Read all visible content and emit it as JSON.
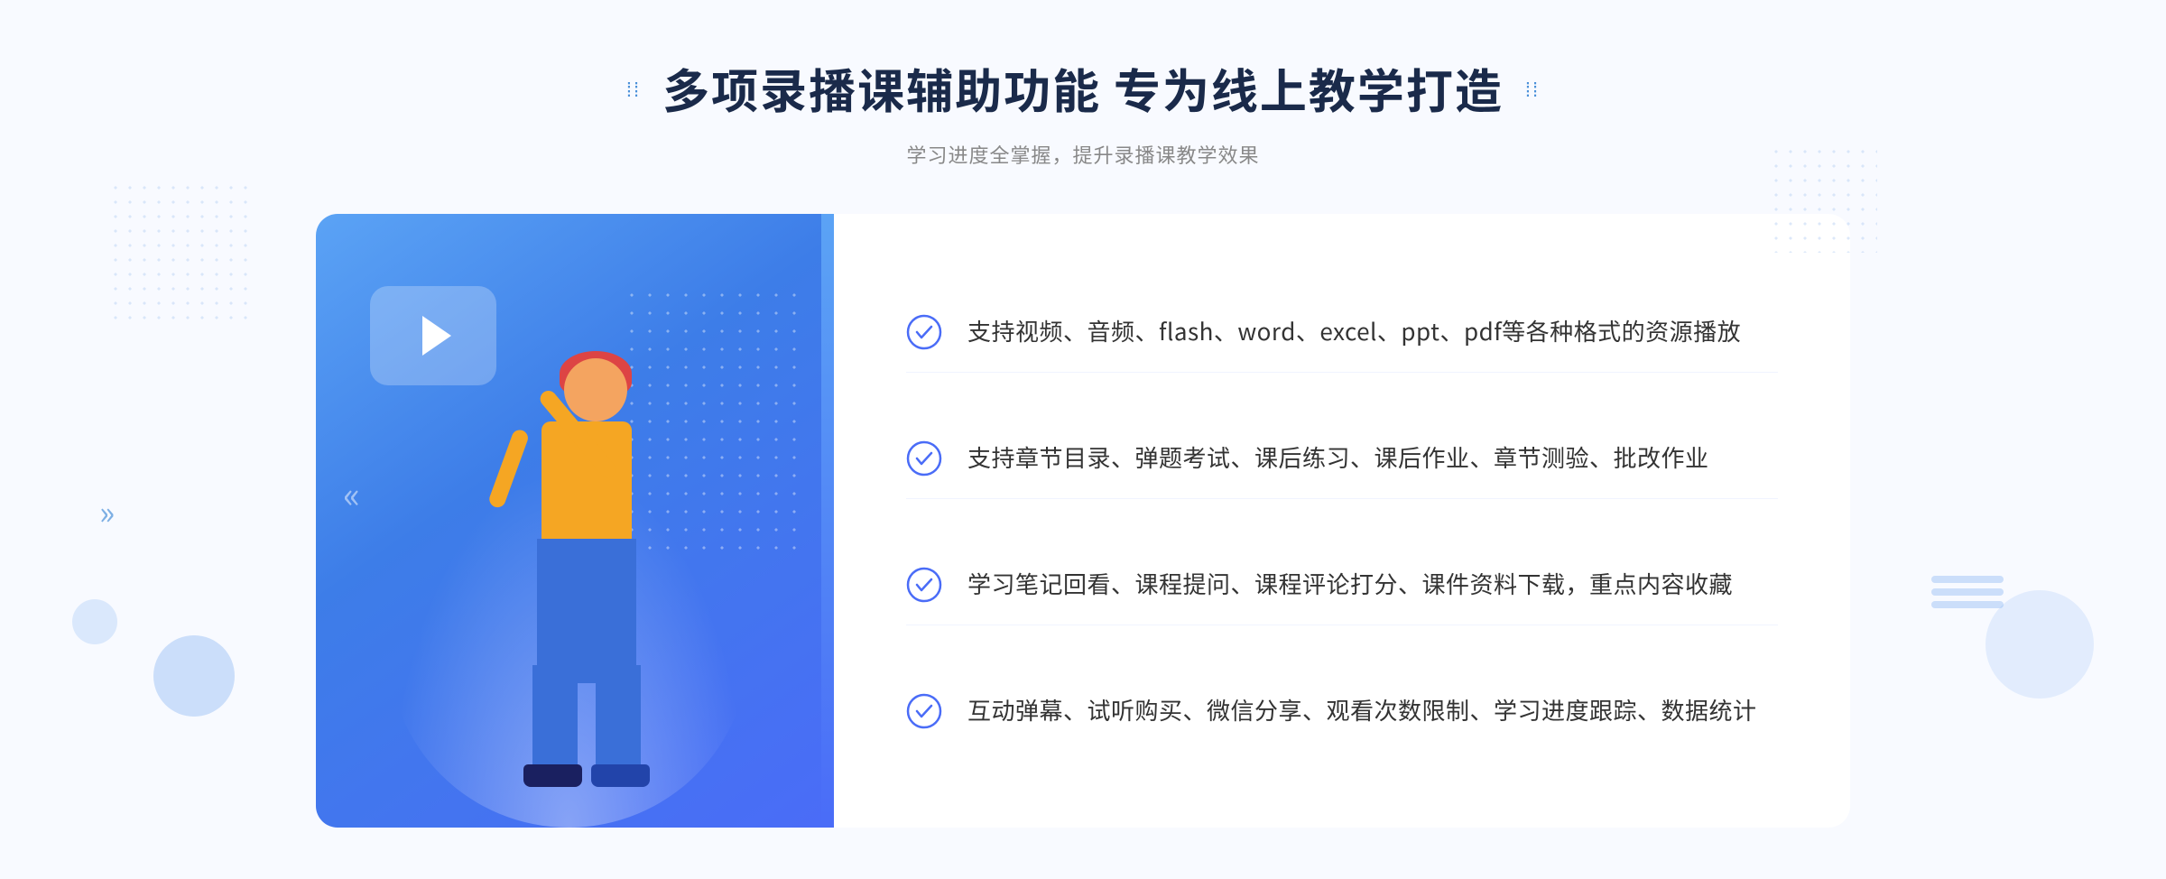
{
  "header": {
    "dots_left": "⁞⁞",
    "dots_right": "⁞⁞",
    "title": "多项录播课辅助功能 专为线上教学打造",
    "subtitle": "学习进度全掌握，提升录播课教学效果"
  },
  "features": [
    {
      "id": "feature-1",
      "text": "支持视频、音频、flash、word、excel、ppt、pdf等各种格式的资源播放"
    },
    {
      "id": "feature-2",
      "text": "支持章节目录、弹题考试、课后练习、课后作业、章节测验、批改作业"
    },
    {
      "id": "feature-3",
      "text": "学习笔记回看、课程提问、课程评论打分、课件资料下载，重点内容收藏"
    },
    {
      "id": "feature-4",
      "text": "互动弹幕、试听购买、微信分享、观看次数限制、学习进度跟踪、数据统计"
    }
  ],
  "colors": {
    "accent": "#4a6cf7",
    "blue_gradient_start": "#5ba3f5",
    "blue_gradient_end": "#3d7de8",
    "text_dark": "#1a2a4a",
    "text_gray": "#888888",
    "text_body": "#333333"
  },
  "icons": {
    "check": "check-circle-icon",
    "play": "play-icon",
    "chevron": "chevron-right-icon"
  }
}
